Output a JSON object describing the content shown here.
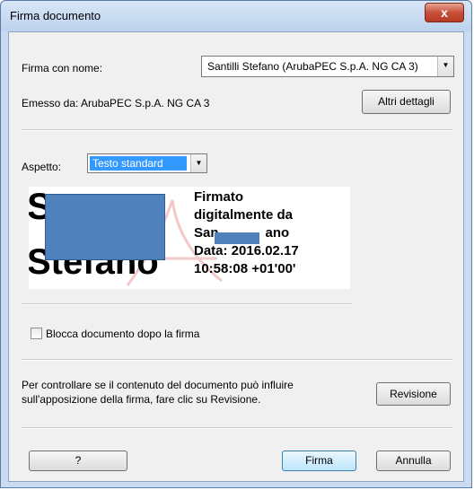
{
  "window": {
    "title": "Firma documento",
    "close_label": "x"
  },
  "sign_as": {
    "label": "Firma con nome:",
    "value": "Santilli Stefano (ArubaPEC S.p.A. NG CA 3)"
  },
  "issuer": {
    "text": "Emesso da: ArubaPEC S.p.A. NG CA 3",
    "details_button": "Altri dettagli"
  },
  "appearance": {
    "label": "Aspetto:",
    "value": "Testo standard"
  },
  "preview": {
    "big_initial": "S",
    "big_name": "Stefano",
    "sig_line1": "Firmato",
    "sig_line2": "digitalmente da",
    "sig_name_left": "San",
    "sig_name_right": "ano",
    "sig_date": "Data: 2016.02.17",
    "sig_time": "10:58:08 +01'00'"
  },
  "lock": {
    "label": "Blocca documento dopo la firma",
    "checked": false
  },
  "review": {
    "line1": "Per controllare se il contenuto del documento può influire",
    "line2": "sull'apposizione della firma, fare clic su Revisione.",
    "button": "Revisione"
  },
  "footer": {
    "help_button": "?",
    "sign_button": "Firma",
    "cancel_button": "Annulla"
  }
}
